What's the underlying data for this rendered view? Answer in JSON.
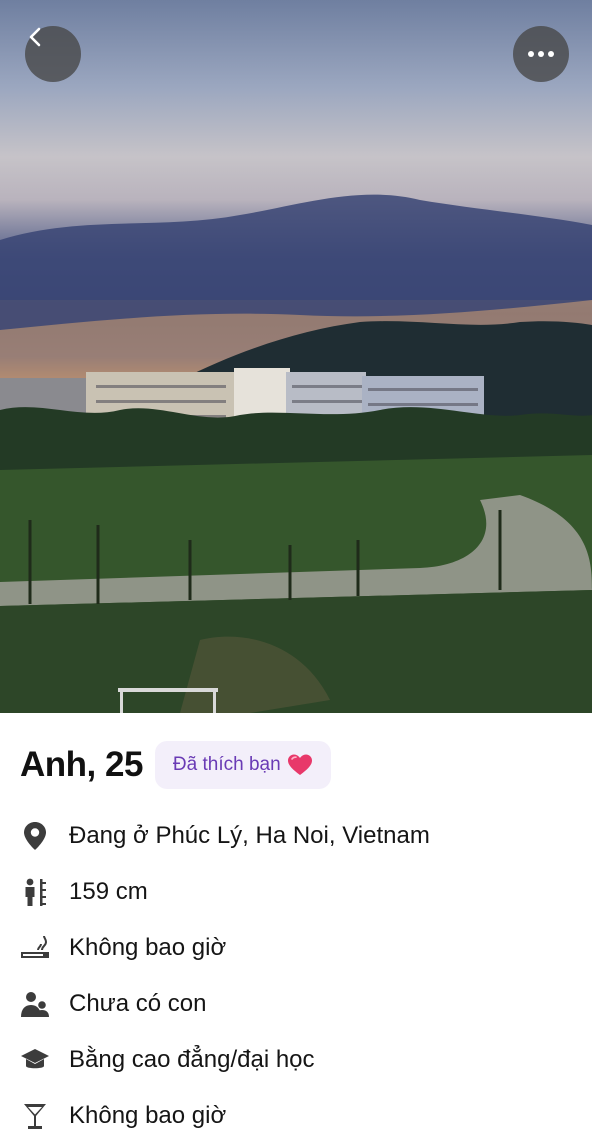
{
  "profile": {
    "name_age": "Anh, 25",
    "liked_badge": "Đã thích bạn",
    "details": [
      {
        "icon": "location-pin-icon",
        "text": "Đang ở Phúc Lý, Ha Noi, Vietnam"
      },
      {
        "icon": "height-icon",
        "text": "159 cm"
      },
      {
        "icon": "smoking-icon",
        "text": "Không bao giờ"
      },
      {
        "icon": "children-icon",
        "text": "Chưa có con"
      },
      {
        "icon": "education-cap-icon",
        "text": "Bằng cao đẳng/đại học"
      },
      {
        "icon": "drinking-glass-icon",
        "text": "Không bao giờ"
      }
    ]
  },
  "colors": {
    "badge_bg": "#f3effa",
    "badge_text": "#6a3bb5",
    "heart": "#e8386a",
    "icon_gray": "#3c3c3c"
  },
  "photo": {
    "icon": "profile-photo"
  }
}
